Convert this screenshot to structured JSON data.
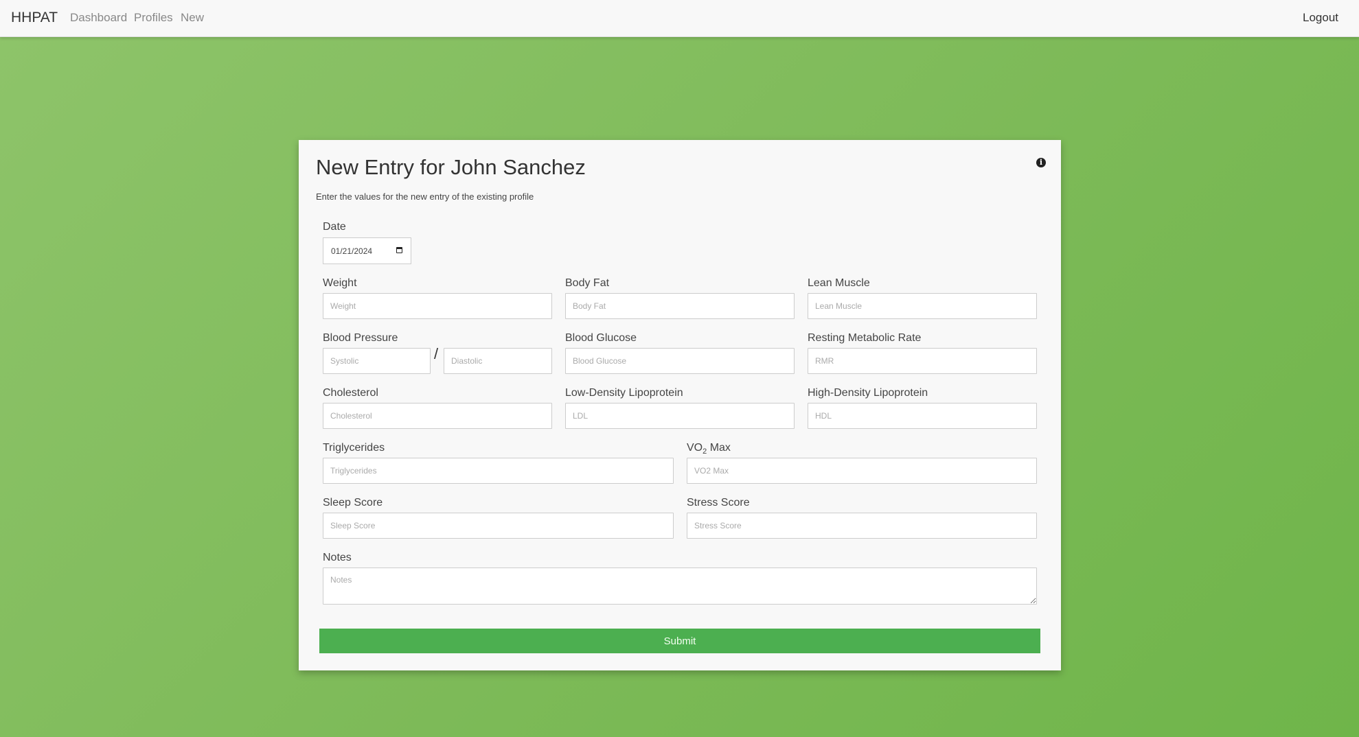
{
  "navbar": {
    "brand": "HHPAT",
    "links": [
      "Dashboard",
      "Profiles",
      "New"
    ],
    "logout": "Logout"
  },
  "form": {
    "title": "New Entry for John Sanchez",
    "subtitle": "Enter the values for the new entry of the existing profile",
    "info_icon": "info-circle-icon",
    "date": {
      "label": "Date",
      "value": "01/21/2024",
      "icon": "calendar-icon"
    },
    "weight": {
      "label": "Weight",
      "placeholder": "Weight"
    },
    "body_fat": {
      "label": "Body Fat",
      "placeholder": "Body Fat"
    },
    "lean_muscle": {
      "label": "Lean Muscle",
      "placeholder": "Lean Muscle"
    },
    "blood_pressure": {
      "label": "Blood Pressure",
      "systolic_placeholder": "Systolic",
      "separator": "/",
      "diastolic_placeholder": "Diastolic"
    },
    "blood_glucose": {
      "label": "Blood Glucose",
      "placeholder": "Blood Glucose"
    },
    "rmr": {
      "label": "Resting Metabolic Rate",
      "placeholder": "RMR"
    },
    "cholesterol": {
      "label": "Cholesterol",
      "placeholder": "Cholesterol"
    },
    "ldl": {
      "label": "Low-Density Lipoprotein",
      "placeholder": "LDL"
    },
    "hdl": {
      "label": "High-Density Lipoprotein",
      "placeholder": "HDL"
    },
    "triglycerides": {
      "label": "Triglycerides",
      "placeholder": "Triglycerides"
    },
    "vo2": {
      "label_prefix": "VO",
      "label_sub": "2",
      "label_suffix": " Max",
      "placeholder": "VO2 Max"
    },
    "sleep_score": {
      "label": "Sleep Score",
      "placeholder": "Sleep Score"
    },
    "stress_score": {
      "label": "Stress Score",
      "placeholder": "Stress Score"
    },
    "notes": {
      "label": "Notes",
      "placeholder": "Notes"
    },
    "submit_label": "Submit"
  },
  "colors": {
    "background": "#7dba58",
    "submit": "#4caf50",
    "card": "#f8f8f8"
  }
}
